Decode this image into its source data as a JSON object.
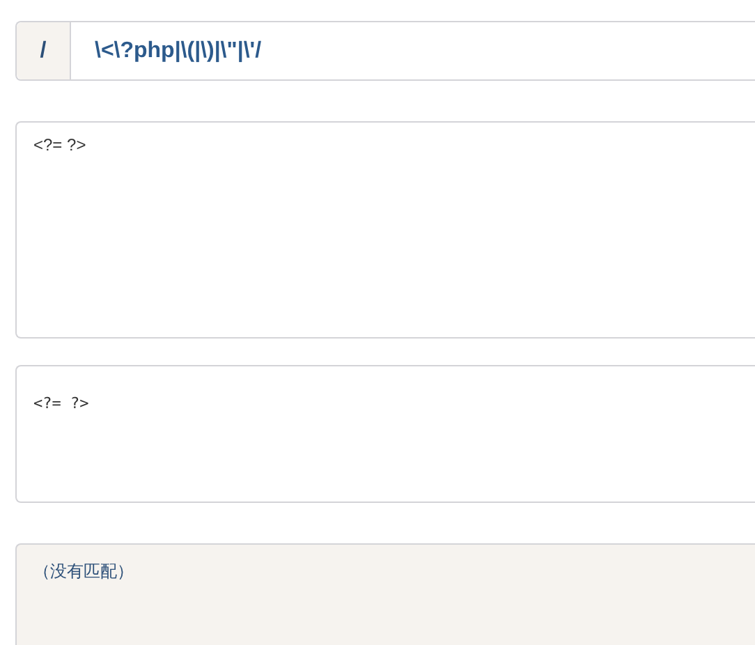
{
  "regex_bar": {
    "delimiter": "/",
    "pattern": "\\<\\?php|\\(|\\)|\\\"|\\'/"
  },
  "input_text": {
    "value": "<?= ?>"
  },
  "output_text": {
    "value": "<?= ?>"
  },
  "match_result": {
    "text": "（没有匹配）"
  }
}
